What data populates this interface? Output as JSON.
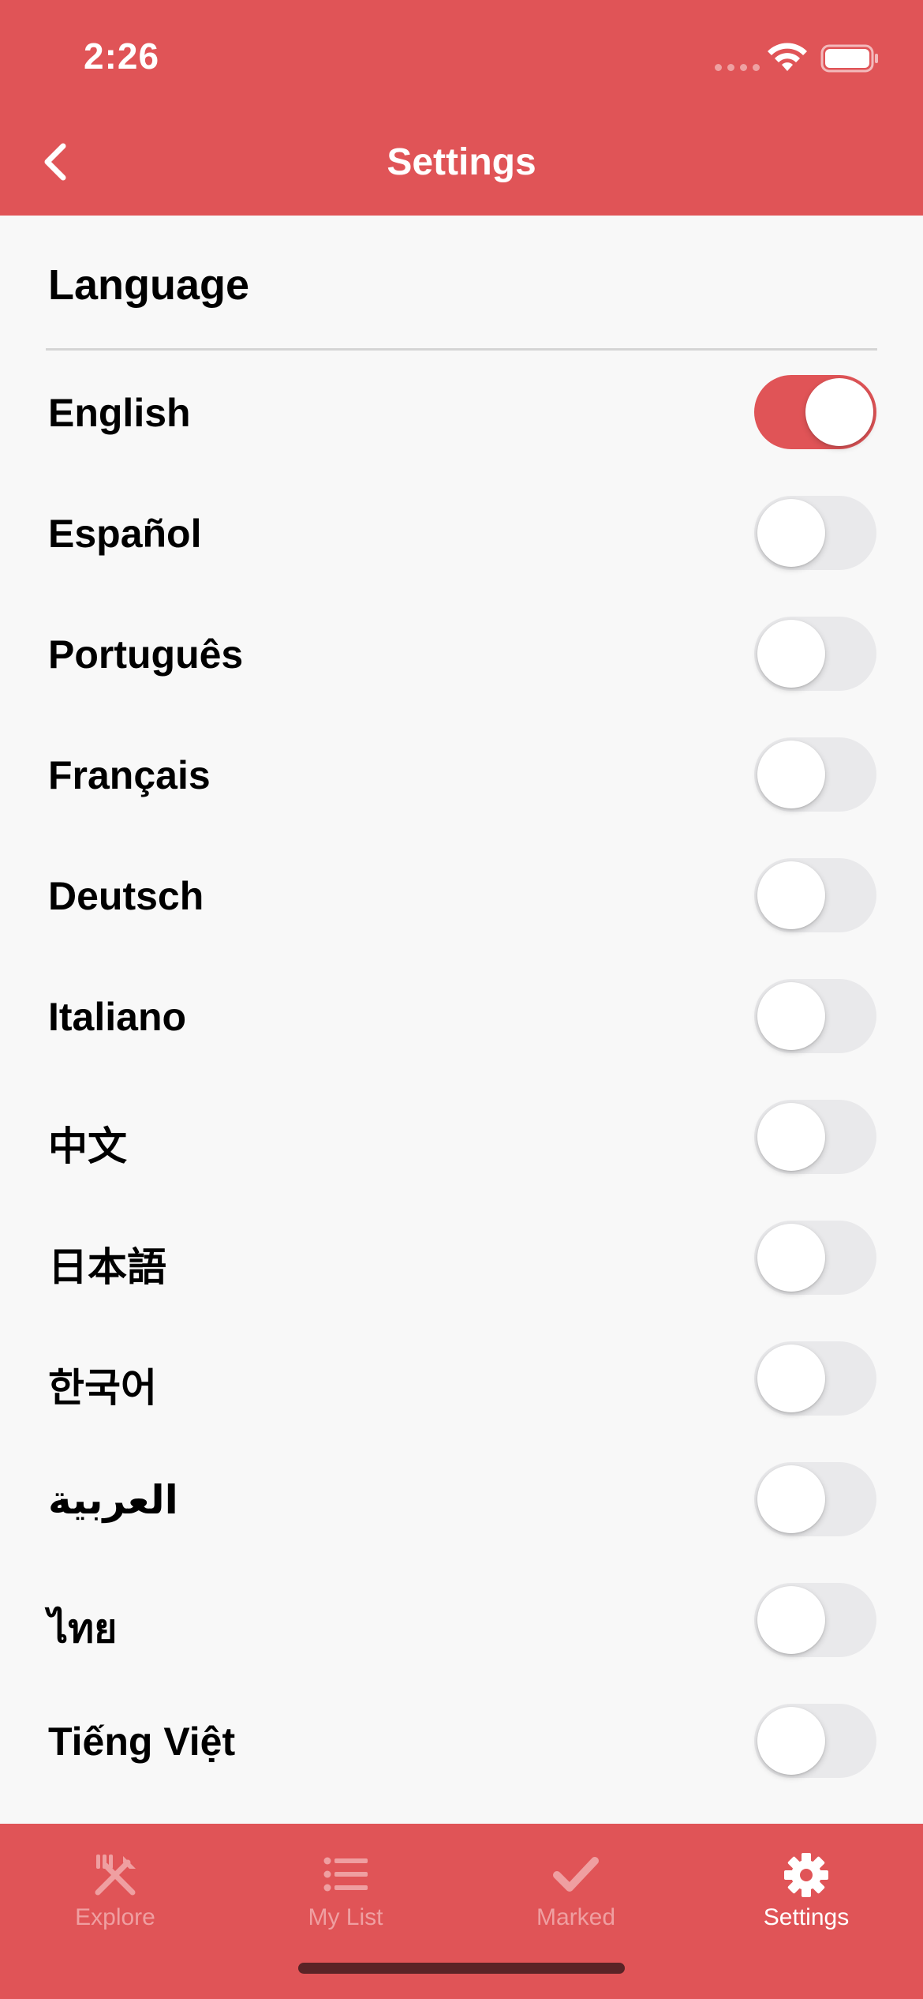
{
  "status_bar": {
    "time": "2:26"
  },
  "header": {
    "title": "Settings",
    "back_icon": "chevron-left-icon"
  },
  "section": {
    "title": "Language"
  },
  "languages": [
    {
      "label": "English",
      "enabled": true
    },
    {
      "label": "Español",
      "enabled": false
    },
    {
      "label": "Português",
      "enabled": false
    },
    {
      "label": "Français",
      "enabled": false
    },
    {
      "label": "Deutsch",
      "enabled": false
    },
    {
      "label": "Italiano",
      "enabled": false
    },
    {
      "label": "中文",
      "enabled": false
    },
    {
      "label": "日本語",
      "enabled": false
    },
    {
      "label": "한국어",
      "enabled": false
    },
    {
      "label": "العربية",
      "enabled": false
    },
    {
      "label": "ไทย",
      "enabled": false
    },
    {
      "label": "Tiếng Việt",
      "enabled": false
    }
  ],
  "tabbar": {
    "tabs": [
      {
        "label": "Explore",
        "icon": "utensils-icon",
        "active": false
      },
      {
        "label": "My List",
        "icon": "list-icon",
        "active": false
      },
      {
        "label": "Marked",
        "icon": "checkmark-icon",
        "active": false
      },
      {
        "label": "Settings",
        "icon": "gear-icon",
        "active": true
      }
    ]
  },
  "colors": {
    "accent": "#e05457",
    "background": "#f8f8f8",
    "toggle_off": "#e9e9eb",
    "tab_inactive": "#ef9fa1",
    "tab_active": "#ffffff"
  }
}
